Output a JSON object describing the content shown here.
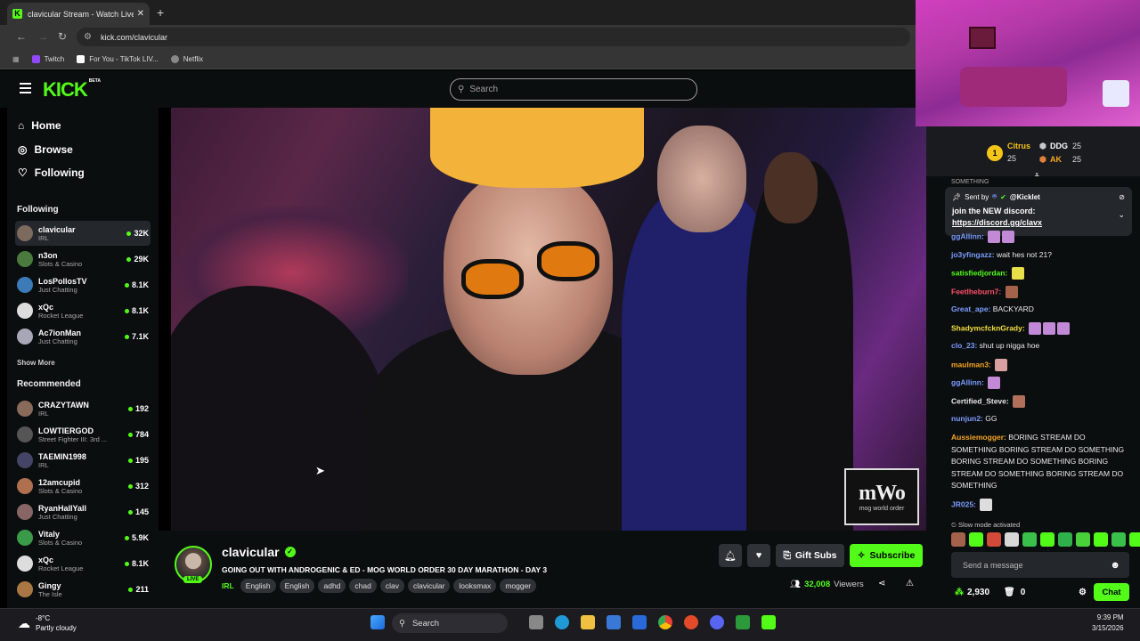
{
  "browser": {
    "tab_title": "clavicular Stream - Watch Live o",
    "tab_close": "✕",
    "new_tab": "+",
    "url": "kick.com/clavicular",
    "bookmarks": [
      {
        "label": "Twitch",
        "color": "#9146ff"
      },
      {
        "label": "For You - TikTok LIV...",
        "color": "#ffffff"
      },
      {
        "label": "Netflix",
        "color": "#888888"
      }
    ]
  },
  "site": {
    "logo": "KICK",
    "logo_beta": "BETA",
    "search_placeholder": "Search",
    "accent": "#53fc18"
  },
  "sidebar": {
    "nav": [
      {
        "label": "Home",
        "icon": "⌂"
      },
      {
        "label": "Browse",
        "icon": "◎"
      },
      {
        "label": "Following",
        "icon": "♡"
      }
    ],
    "following_title": "Following",
    "following": [
      {
        "name": "clavicular",
        "category": "IRL",
        "viewers": "32K",
        "color": "#7c6a5c"
      },
      {
        "name": "n3on",
        "category": "Slots & Casino",
        "viewers": "29K",
        "color": "#4a7a3c"
      },
      {
        "name": "LosPollosTV",
        "category": "Just Chatting",
        "viewers": "8.1K",
        "color": "#3c7ab8"
      },
      {
        "name": "xQc",
        "category": "Rocket League",
        "viewers": "8.1K",
        "color": "#dddddd"
      },
      {
        "name": "Ac7ionMan",
        "category": "Just Chatting",
        "viewers": "7.1K",
        "color": "#a7a7b7"
      }
    ],
    "show_more": "Show More",
    "recommended_title": "Recommended",
    "recommended": [
      {
        "name": "CRAZYTAWN",
        "category": "IRL",
        "viewers": "192",
        "color": "#8a6a5a"
      },
      {
        "name": "LOWTIERGOD",
        "category": "Street Fighter III: 3rd ...",
        "viewers": "784",
        "color": "#555555"
      },
      {
        "name": "TAEMIN1998",
        "category": "IRL",
        "viewers": "195",
        "color": "#444466"
      },
      {
        "name": "12amcupid",
        "category": "Slots & Casino",
        "viewers": "312",
        "color": "#b07050"
      },
      {
        "name": "RyanHallYall",
        "category": "Just Chatting",
        "viewers": "145",
        "color": "#886666"
      },
      {
        "name": "Vitaly",
        "category": "Slots & Casino",
        "viewers": "5.9K",
        "color": "#3a9a4a"
      },
      {
        "name": "xQc",
        "category": "Rocket League",
        "viewers": "8.1K",
        "color": "#dddddd"
      },
      {
        "name": "Gingy",
        "category": "The Isle",
        "viewers": "211",
        "color": "#aa7744"
      }
    ]
  },
  "video": {
    "watermark_big": "mWo",
    "watermark_small": "mog world order"
  },
  "stream": {
    "name": "clavicular",
    "live": "LIVE",
    "title": "GOING OUT WITH ANDROGENIC & ED - MOG WORLD ORDER 30 DAY MARATHON - DAY 3",
    "category": "IRL",
    "tags": [
      "English",
      "English",
      "adhd",
      "chad",
      "clav",
      "clavicular",
      "looksmax",
      "mogger"
    ],
    "gift_label": "Gift Subs",
    "subscribe_label": "Subscribe",
    "viewers": "32,008",
    "viewers_label": "Viewers"
  },
  "chat": {
    "leaderboard": [
      {
        "rank": "1",
        "name": "Citrus",
        "count": "25"
      },
      {
        "name": "DDG",
        "count": "25"
      },
      {
        "name": "AK",
        "count": "25"
      }
    ],
    "pinned_partial": "SOMETHING",
    "pinned": {
      "sent_by": "Sent by",
      "user": "@Kicklet",
      "message": "join the NEW discord:",
      "link": "https://discord.gg/clavx"
    },
    "messages": [
      {
        "user": "ggAllinn:",
        "color": "#7b9cff",
        "text": "",
        "emotes": [
          "#c28ad6",
          "#c28ad6"
        ]
      },
      {
        "user": "jo3yfingazz:",
        "color": "#7b9cff",
        "text": "wait hes not 21?",
        "emotes": []
      },
      {
        "user": "satisfiedjordan:",
        "color": "#53fc18",
        "text": "",
        "emotes": [
          "#e8e04a"
        ]
      },
      {
        "user": "Feetlheburn7:",
        "color": "#ff4f6a",
        "text": "",
        "emotes": [
          "#a5624b"
        ]
      },
      {
        "user": "Great_ape:",
        "color": "#7b9cff",
        "text": "BACKYARD",
        "emotes": []
      },
      {
        "user": "ShadymcfcknGrady:",
        "color": "#f0e03a",
        "text": "",
        "emotes": [
          "#c28ad6",
          "#c28ad6",
          "#c28ad6"
        ]
      },
      {
        "user": "clo_23:",
        "color": "#7b9cff",
        "text": "shut up nigga hoe",
        "emotes": []
      },
      {
        "user": "maulman3:",
        "color": "#f5a623",
        "text": "",
        "emotes": [
          "#d8a0a0"
        ]
      },
      {
        "user": "ggAllinn:",
        "color": "#7b9cff",
        "text": "",
        "emotes": [
          "#c28ad6"
        ]
      },
      {
        "user": "Certified_Steve:",
        "color": "#e8e8e8",
        "text": "",
        "emotes": [
          "#b0705a"
        ]
      },
      {
        "user": "nunjun2:",
        "color": "#7b9cff",
        "text": "GG",
        "emotes": []
      },
      {
        "user": "Aussiemogger:",
        "color": "#f5a623",
        "text": "BORING STREAM DO SOMETHING BORING STREAM DO SOMETHING BORING STREAM DO SOMETHING BORING STREAM DO SOMETHING BORING STREAM DO SOMETHING",
        "emotes": []
      },
      {
        "user": "JR025:",
        "color": "#7b9cff",
        "text": "",
        "emotes": [
          "#dddddd"
        ]
      }
    ],
    "slow_mode": "Slow mode activated",
    "input_placeholder": "Send a message",
    "points": "2,930",
    "items": "0",
    "chat_button": "Chat"
  },
  "taskbar": {
    "temp": "-8°C",
    "weather": "Partly cloudy",
    "search": "Search",
    "time": "9:39 PM",
    "date": "3/15/2026"
  }
}
